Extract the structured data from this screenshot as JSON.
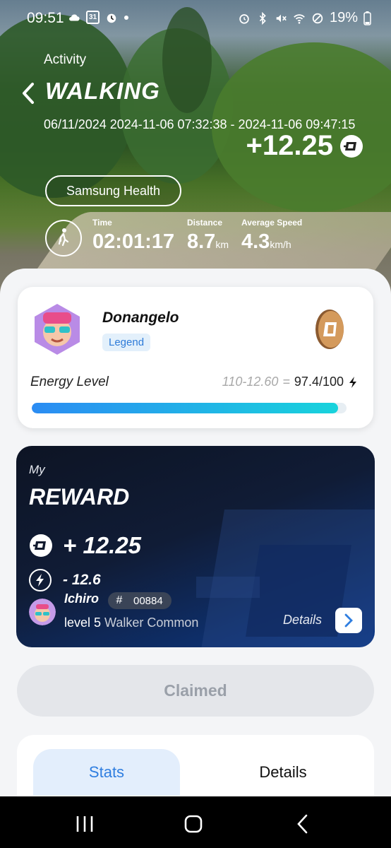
{
  "status_bar": {
    "time": "09:51",
    "calendar_day": "31",
    "battery": "19%",
    "icons_left": [
      "cloud-icon",
      "calendar-icon",
      "alarm-icon",
      "dot-icon"
    ],
    "icons_right": [
      "alarm-icon",
      "bluetooth-icon",
      "mute-icon",
      "wifi-icon",
      "do-not-disturb-icon",
      "battery-icon"
    ]
  },
  "header": {
    "section_label": "Activity",
    "title": "WALKING",
    "date_range": "06/11/2024 2024-11-06 07:32:38 - 2024-11-06 09:47:15",
    "reward_total": "+12.25",
    "source": "Samsung Health"
  },
  "stats": {
    "time": {
      "label": "Time",
      "value": "02:01:17"
    },
    "distance": {
      "label": "Distance",
      "value": "8.7",
      "unit": "km"
    },
    "speed": {
      "label": "Average Speed",
      "value": "4.3",
      "unit": "km/h"
    }
  },
  "profile": {
    "name": "Donangelo",
    "tier": "Legend",
    "energy_label": "Energy Level",
    "energy_calc": "110-12.60",
    "energy_eq": "=",
    "energy_value": "97.4/100",
    "energy_fraction": 0.974
  },
  "reward": {
    "prefix": "My",
    "title": "REWARD",
    "coin_amount": "+ 12.25",
    "energy_amount": "- 12.6",
    "walker_name": "Ichiro",
    "nft_hash": "#",
    "nft_id": "00884",
    "level_text": "level 5",
    "rarity": "Walker Common",
    "details_label": "Details"
  },
  "claim_button": "Claimed",
  "tabs": [
    {
      "label": "Stats",
      "active": true
    },
    {
      "label": "Details",
      "active": false
    }
  ],
  "colors": {
    "accent_blue": "#2f7ee0",
    "energy_start": "#2b8cf3",
    "energy_end": "#18d3dc",
    "reward_card": "#0d1424",
    "coin": "#c98a4b"
  }
}
